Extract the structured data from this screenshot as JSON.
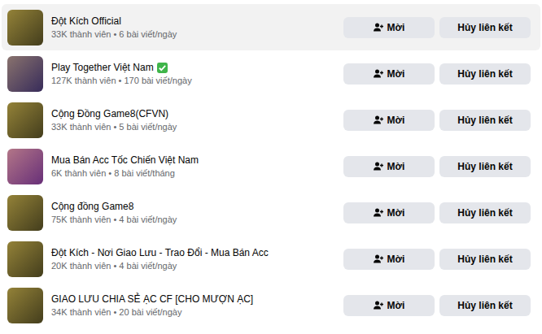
{
  "actions": {
    "invite": "Mời",
    "unlink": "Hủy liên kết"
  },
  "groups": [
    {
      "name": "Đột Kích Official",
      "meta": "33K thành viên • 6 bài viết/ngày",
      "verified": false,
      "highlighted": true,
      "color": "#5a5226"
    },
    {
      "name": "Play Together Việt Nam",
      "meta": "127K thành viên • 170 bài viết/ngày",
      "verified": true,
      "highlighted": false,
      "color": "#4a3a78"
    },
    {
      "name": "Cộng Đồng Game8(CFVN)",
      "meta": "33K thành viên • 5 bài viết/ngày",
      "verified": false,
      "highlighted": false,
      "color": "#5a5226"
    },
    {
      "name": "Mua Bán Acc Tốc Chiến Việt Nam",
      "meta": "6K thành viên • 8 bài viết/tháng",
      "verified": false,
      "highlighted": false,
      "color": "#8a3fa0"
    },
    {
      "name": "Cộng đồng Game8",
      "meta": "75K thành viên • 4 bài viết/ngày",
      "verified": false,
      "highlighted": false,
      "color": "#5a5226"
    },
    {
      "name": "Đột Kích - Nơi Giao Lưu - Trao Đổi - Mua Bán Acc",
      "meta": "20K thành viên • 4 bài viết/ngày",
      "verified": false,
      "highlighted": false,
      "color": "#5a5226"
    },
    {
      "name": "GIAO LƯU CHIA SẺ ẠC CF [CHO MƯỢN ẠC]",
      "meta": "34K thành viên • 20 bài viết/ngày",
      "verified": false,
      "highlighted": false,
      "color": "#5a5226"
    }
  ]
}
